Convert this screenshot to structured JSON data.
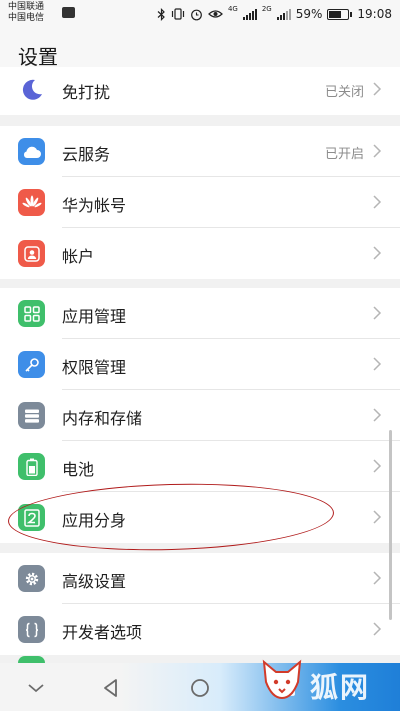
{
  "status": {
    "carrier_1": "中国联通",
    "carrier_2": "中国电信",
    "battery": "59%",
    "time": "19:08",
    "net_1": "4G",
    "net_2": "2G"
  },
  "header": {
    "title": "设置"
  },
  "groups": [
    {
      "items": [
        {
          "label": "免打扰",
          "value": "已关闭",
          "icon": "moon-icon",
          "color": "#5a64d6"
        }
      ]
    },
    {
      "items": [
        {
          "label": "云服务",
          "value": "已开启",
          "icon": "cloud-icon",
          "color": "#3e8ee8"
        },
        {
          "label": "华为帐号",
          "value": "",
          "icon": "huawei-logo-icon",
          "color": "#ef5a49"
        },
        {
          "label": "帐户",
          "value": "",
          "icon": "account-icon",
          "color": "#ef5a49"
        }
      ]
    },
    {
      "items": [
        {
          "label": "应用管理",
          "value": "",
          "icon": "app-grid-icon",
          "color": "#3fbf6b"
        },
        {
          "label": "权限管理",
          "value": "",
          "icon": "key-icon",
          "color": "#3e8ee8"
        },
        {
          "label": "内存和存储",
          "value": "",
          "icon": "storage-icon",
          "color": "#7d8a99"
        },
        {
          "label": "电池",
          "value": "",
          "icon": "battery-icon",
          "color": "#3fbf6b"
        },
        {
          "label": "应用分身",
          "value": "",
          "icon": "app-twin-icon",
          "color": "#3fbf6b"
        }
      ]
    },
    {
      "items": [
        {
          "label": "高级设置",
          "value": "",
          "icon": "gear-icon",
          "color": "#7d8a99"
        },
        {
          "label": "开发者选项",
          "value": "",
          "icon": "braces-icon",
          "color": "#7d8a99"
        }
      ]
    }
  ],
  "watermark": {
    "text": "狐网"
  }
}
